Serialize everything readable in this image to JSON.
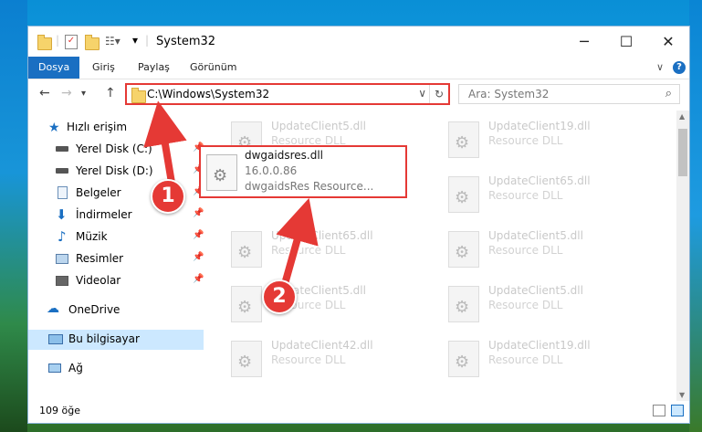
{
  "window": {
    "title": "System32"
  },
  "ribbon": {
    "tabs": [
      "Dosya",
      "Giriş",
      "Paylaş",
      "Görünüm"
    ],
    "help": "?"
  },
  "address": {
    "path": "C:\\Windows\\System32",
    "search_placeholder": "Ara: System32"
  },
  "sidebar": {
    "items": [
      {
        "label": "Hızlı erişim",
        "icon": "star-icon"
      },
      {
        "label": "Yerel Disk (C:)",
        "icon": "drive-icon"
      },
      {
        "label": "Yerel Disk (D:)",
        "icon": "drive-icon"
      },
      {
        "label": "Belgeler",
        "icon": "documents-icon"
      },
      {
        "label": "İndirmeler",
        "icon": "download-icon"
      },
      {
        "label": "Müzik",
        "icon": "music-icon"
      },
      {
        "label": "Resimler",
        "icon": "pictures-icon"
      },
      {
        "label": "Videolar",
        "icon": "video-icon"
      },
      {
        "label": "OneDrive",
        "icon": "cloud-icon"
      },
      {
        "label": "Bu bilgisayar",
        "icon": "computer-icon"
      },
      {
        "label": "Ağ",
        "icon": "network-icon"
      }
    ]
  },
  "files": [
    {
      "name": "UpdateClient5.dll",
      "desc": "Resource DLL"
    },
    {
      "name": "UpdateClient19.dll",
      "desc": "Resource DLL"
    },
    {
      "name": "UpdateClient65.dll",
      "desc": "Resource DLL"
    },
    {
      "name": "UpdateClient65.dll",
      "desc": "Resource DLL"
    },
    {
      "name": "UpdateClient5.dll",
      "desc": "Resource DLL"
    },
    {
      "name": "UpdateClient5.dll",
      "desc": "Resource DLL"
    },
    {
      "name": "UpdateClient5.dll",
      "desc": "Resource DLL"
    },
    {
      "name": "UpdateClient42.dll",
      "desc": "Resource DLL"
    },
    {
      "name": "UpdateClient19.dll",
      "desc": "Resource DLL"
    }
  ],
  "highlighted_file": {
    "name": "dwgaidsres.dll",
    "version": "16.0.0.86",
    "desc": "dwgaidsRes Resource..."
  },
  "status": {
    "count": "109 öğe"
  },
  "callouts": {
    "one": "1",
    "two": "2"
  },
  "colors": {
    "accent": "#1a6fc2",
    "highlight": "#e53935"
  }
}
